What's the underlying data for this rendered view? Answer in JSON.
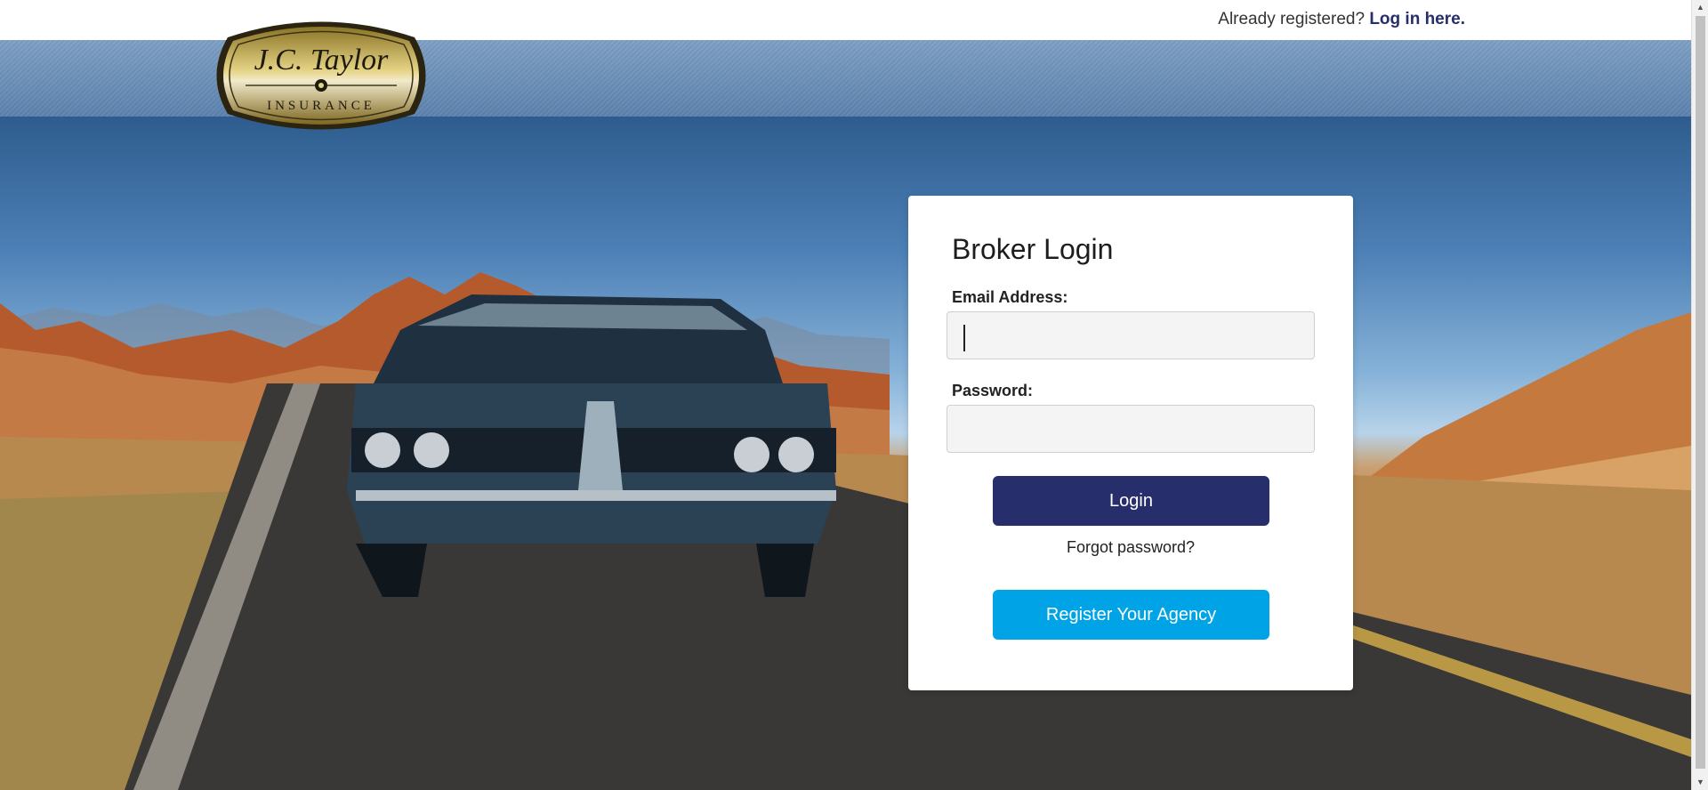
{
  "header": {
    "already_registered_text": "Already registered?",
    "login_link_label": "Log in here.",
    "logo_text_main": "J.C. Taylor",
    "logo_text_sub": "INSURANCE"
  },
  "login_card": {
    "title": "Broker Login",
    "email_label": "Email Address:",
    "email_value": "",
    "password_label": "Password:",
    "password_value": "",
    "login_button_label": "Login",
    "forgot_password_label": "Forgot password?",
    "register_button_label": "Register Your Agency"
  },
  "colors": {
    "login_button": "#262e6b",
    "register_button": "#00a3e6",
    "link": "#262e6b"
  },
  "icons": [
    "scroll-up-arrow-icon",
    "scroll-down-arrow-icon"
  ]
}
